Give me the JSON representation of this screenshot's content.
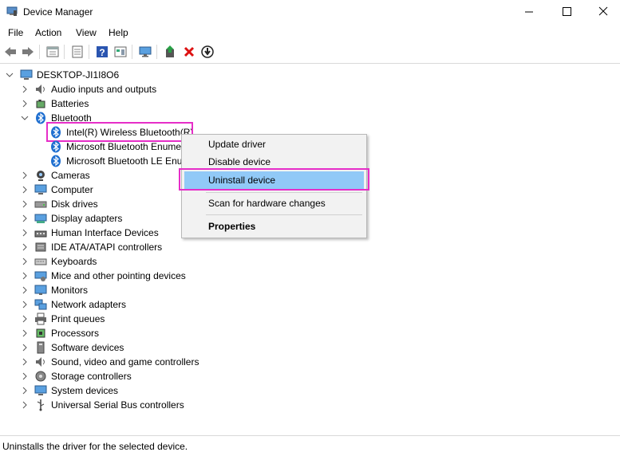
{
  "window": {
    "title": "Device Manager"
  },
  "menu": [
    "File",
    "Action",
    "View",
    "Help"
  ],
  "toolbar": [
    "back-icon",
    "forward-icon",
    "show-hide-icon",
    "properties-icon",
    "help-icon",
    "view-icon",
    "monitor-icon",
    "update-driver-icon",
    "uninstall-icon",
    "download-icon"
  ],
  "tree": {
    "root": "DESKTOP-JI1I8O6",
    "categories": [
      {
        "label": "Audio inputs and outputs",
        "icon": "speaker-icon"
      },
      {
        "label": "Batteries",
        "icon": "battery-icon"
      },
      {
        "label": "Bluetooth",
        "icon": "bluetooth-icon",
        "expanded": true,
        "children": [
          "Intel(R) Wireless Bluetooth(R)",
          "Microsoft Bluetooth Enume",
          "Microsoft Bluetooth LE Enu"
        ]
      },
      {
        "label": "Cameras",
        "icon": "camera-icon"
      },
      {
        "label": "Computer",
        "icon": "computer-icon"
      },
      {
        "label": "Disk drives",
        "icon": "disk-icon"
      },
      {
        "label": "Display adapters",
        "icon": "display-adapter-icon"
      },
      {
        "label": "Human Interface Devices",
        "icon": "hid-icon"
      },
      {
        "label": "IDE ATA/ATAPI controllers",
        "icon": "ide-icon"
      },
      {
        "label": "Keyboards",
        "icon": "keyboard-icon"
      },
      {
        "label": "Mice and other pointing devices",
        "icon": "mouse-icon"
      },
      {
        "label": "Monitors",
        "icon": "monitor-icon"
      },
      {
        "label": "Network adapters",
        "icon": "network-icon"
      },
      {
        "label": "Print queues",
        "icon": "printer-icon"
      },
      {
        "label": "Processors",
        "icon": "processor-icon"
      },
      {
        "label": "Software devices",
        "icon": "software-icon"
      },
      {
        "label": "Sound, video and game controllers",
        "icon": "sound-icon"
      },
      {
        "label": "Storage controllers",
        "icon": "storage-icon"
      },
      {
        "label": "System devices",
        "icon": "system-icon"
      },
      {
        "label": "Universal Serial Bus controllers",
        "icon": "usb-icon"
      }
    ]
  },
  "context_menu": {
    "items": [
      "Update driver",
      "Disable device",
      "Uninstall device",
      "Scan for hardware changes",
      "Properties"
    ],
    "selected": "Uninstall device"
  },
  "status": "Uninstalls the driver for the selected device.",
  "colors": {
    "highlight_box": "#e62ec8",
    "menu_selection": "#91c9f7",
    "bluetooth": "#1f6fd0"
  }
}
